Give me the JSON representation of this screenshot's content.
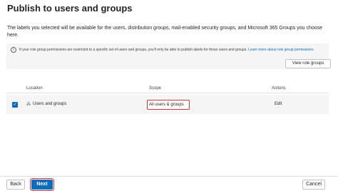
{
  "page": {
    "title": "Publish to users and groups",
    "description": "The labels you selected will be available for the users, distribution groups, mail-enabled security groups, and Microsoft 365 Groups you choose here."
  },
  "info_banner": {
    "icon": "info-icon",
    "text": "If your role group permissions are restricted to a specific set of users and groups, you'll only be able to publish labels for those users and groups.",
    "link_text": "Learn more about role group permissions",
    "button_label": "View role groups"
  },
  "table": {
    "headers": {
      "location": "Location",
      "scope": "Scope",
      "actions": "Actions"
    },
    "rows": [
      {
        "checked": true,
        "icon": "users-icon",
        "location": "Users and groups",
        "scope": "All users & groups",
        "action": "Edit"
      }
    ]
  },
  "footer": {
    "back_label": "Back",
    "next_label": "Next",
    "cancel_label": "Cancel"
  },
  "colors": {
    "accent": "#0f6cbd",
    "highlight_border": "#d13438",
    "banner_background": "#f5f5f5"
  }
}
